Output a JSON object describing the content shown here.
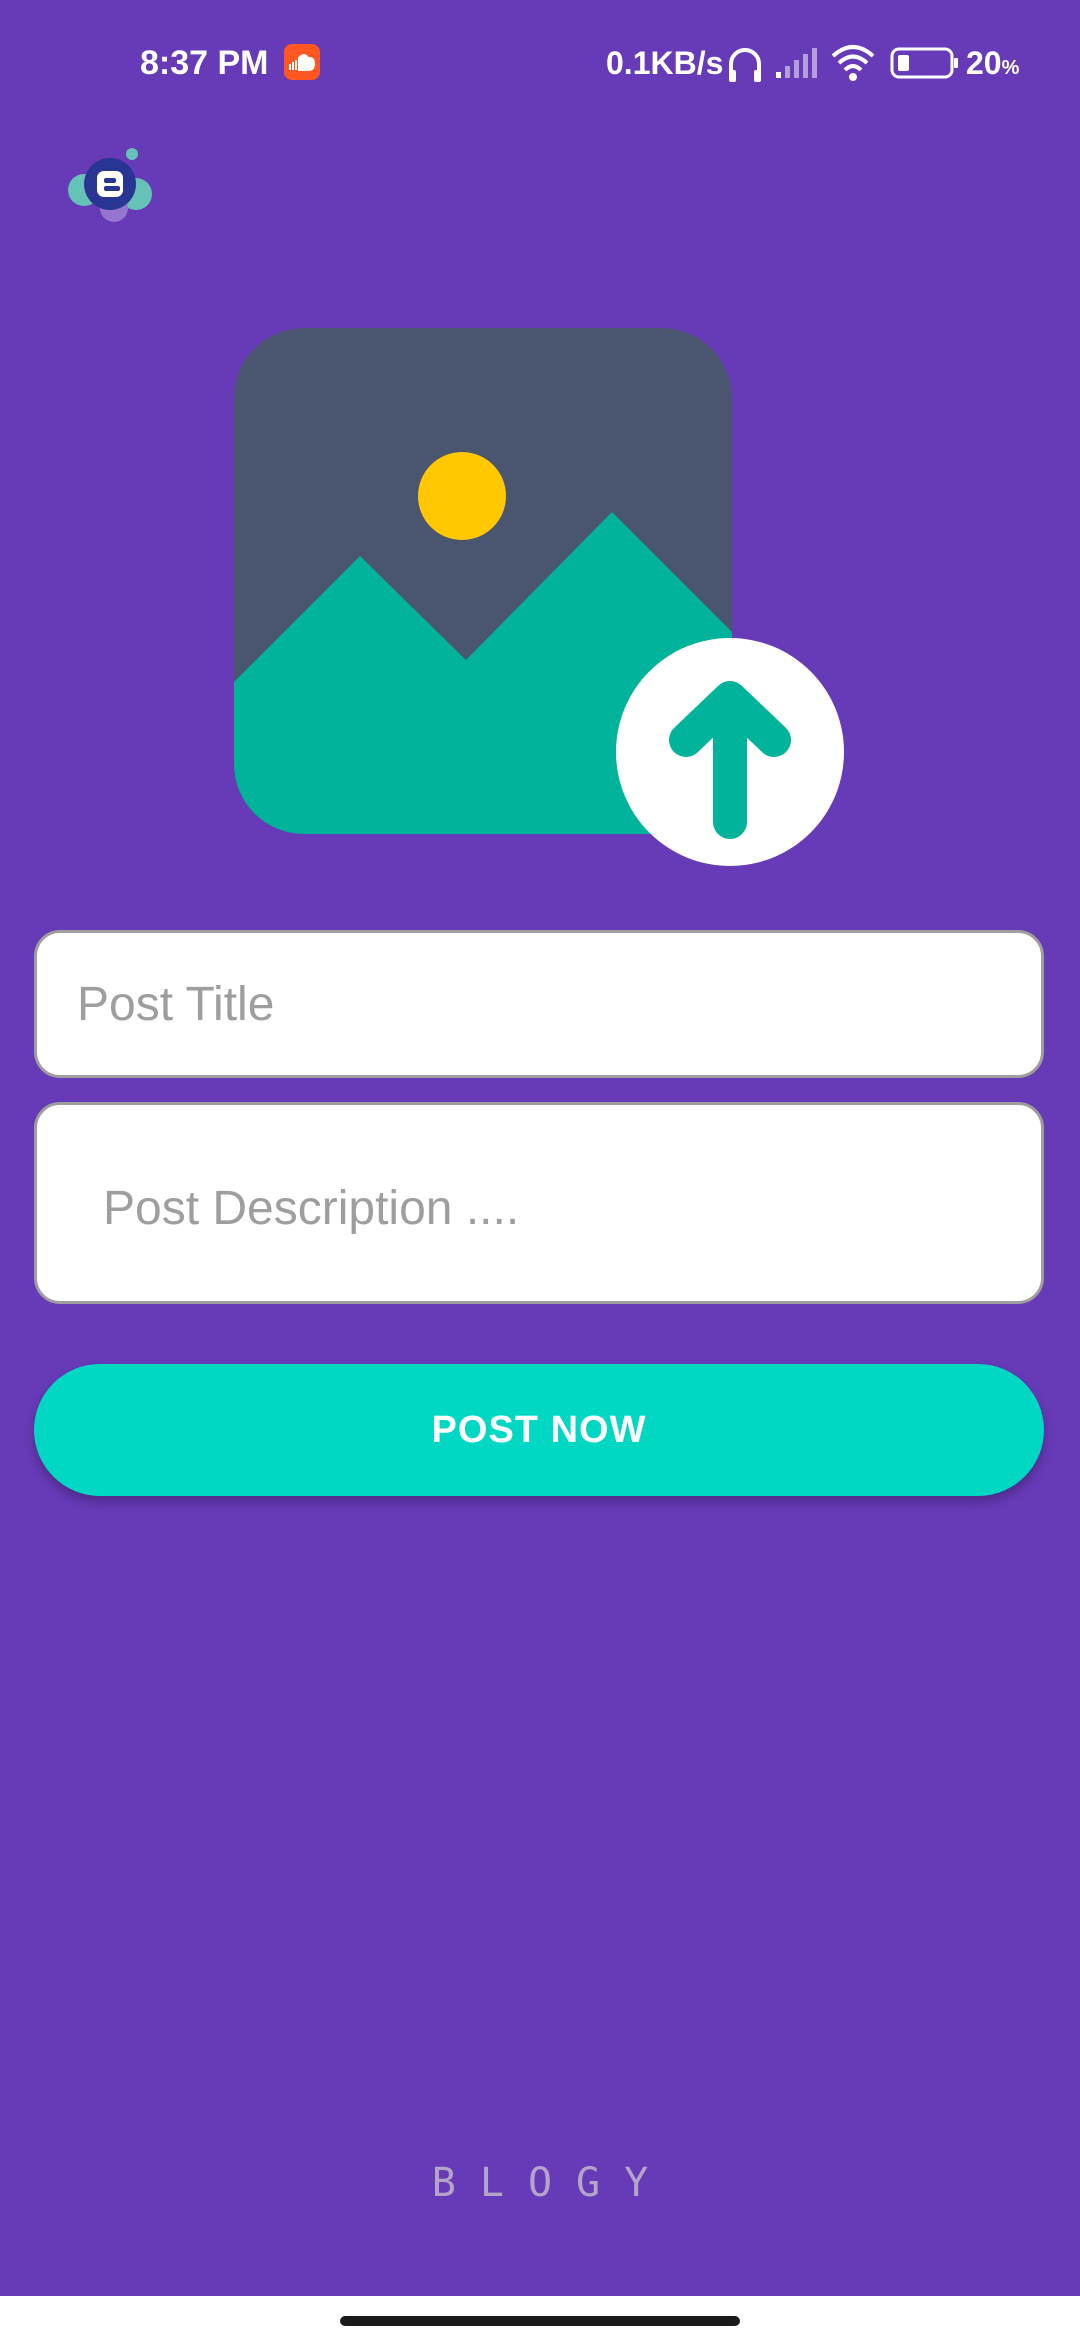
{
  "status_bar": {
    "time": "8:37 PM",
    "network_speed": "0.1KB/s",
    "battery_percent": "20",
    "battery_symbol": "%",
    "icons": [
      "soundcloud-icon",
      "headphones-icon",
      "signal-icon",
      "wifi-icon",
      "battery-icon"
    ]
  },
  "app": {
    "logo_icon": "blogger-logo-icon",
    "upload_icon": "image-upload-icon"
  },
  "form": {
    "title_placeholder": "Post Title",
    "title_value": "",
    "description_placeholder": "Post Description ....",
    "description_value": "",
    "submit_label": "POST NOW"
  },
  "footer": {
    "brand": "BLOGY"
  },
  "colors": {
    "background": "#673ab7",
    "button": "#00d8c4",
    "image_frame": "#4a5670",
    "mountains": "#00b39a",
    "sun": "#ffc800",
    "soundcloud": "#ff5722"
  }
}
